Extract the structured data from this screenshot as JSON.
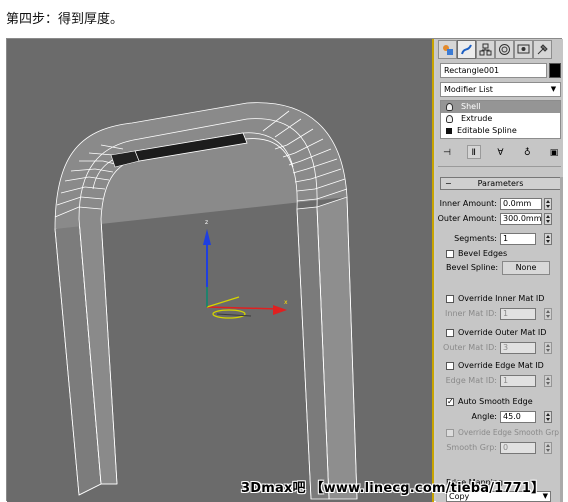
{
  "caption": "第四步：得到厚度。",
  "panel": {
    "tabs": [
      "create-icon",
      "modify-icon",
      "hierarchy-icon",
      "motion-icon",
      "display-icon",
      "utilities-icon"
    ],
    "object_name": "Rectangle001",
    "object_color": "#000000",
    "modifier_list_label": "Modifier List",
    "stack": [
      {
        "label": "Shell",
        "icon": "bulb-icon",
        "selected": true
      },
      {
        "label": "Extrude",
        "icon": "bulb-icon",
        "selected": false
      },
      {
        "label": "Editable Spline",
        "icon": "box-icon",
        "selected": false
      }
    ],
    "parameters": {
      "title": "Parameters",
      "inner_amount_label": "Inner Amount:",
      "inner_amount_value": "0.0mm",
      "outer_amount_label": "Outer Amount:",
      "outer_amount_value": "300.0mm",
      "segments_label": "Segments:",
      "segments_value": "1",
      "bevel_edges_label": "Bevel Edges",
      "bevel_spline_label": "Bevel Spline:",
      "bevel_spline_button": "None",
      "override_inner_label": "Override Inner Mat ID",
      "inner_mat_id_label": "Inner Mat ID:",
      "inner_mat_id_value": "1",
      "override_outer_label": "Override Outer Mat ID",
      "outer_mat_id_label": "Outer Mat ID:",
      "outer_mat_id_value": "3",
      "override_edge_label": "Override Edge Mat ID",
      "edge_mat_id_label": "Edge Mat ID:",
      "edge_mat_id_value": "1",
      "auto_smooth_label": "Auto Smooth Edge",
      "auto_smooth_checked": true,
      "angle_label": "Angle:",
      "angle_value": "45.0",
      "override_edge_smooth_label": "Override Edge Smooth Grp",
      "smooth_grp_label": "Smooth Grp:",
      "smooth_grp_value": "0",
      "edge_mapping_label": "Edge Mapping",
      "edge_mapping_value": "Copy"
    }
  },
  "watermark": "3Dmax吧 【www.linecg.com/tieba/1771】"
}
